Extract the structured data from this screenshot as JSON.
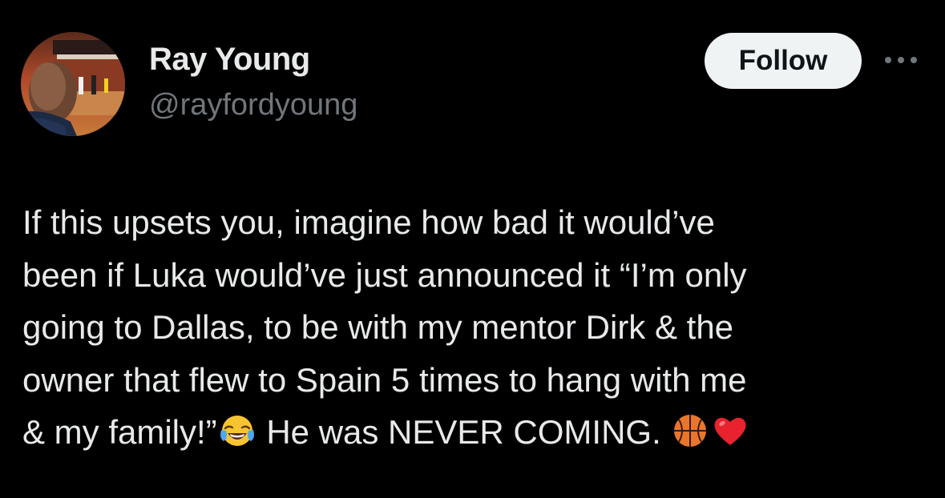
{
  "author": {
    "display_name": "Ray Young",
    "handle": "@rayfordyoung"
  },
  "actions": {
    "follow_label": "Follow",
    "more_icon": "more-horizontal-icon"
  },
  "tweet": {
    "lines": [
      "If this upsets you, imagine how bad it would’ve",
      "been if Luka would’ve just announced it “I’m only",
      "going to Dallas, to be with my mentor Dirk & the",
      "owner that flew to Spain 5 times to hang with me"
    ],
    "last_line_part1": "& my family!”",
    "last_line_part2": " He was NEVER COMING. ",
    "emojis": [
      "tears-of-joy-emoji",
      "basketball-emoji",
      "red-heart-emoji"
    ]
  },
  "colors": {
    "background": "#000000",
    "text_primary": "#e7e9ea",
    "text_secondary": "#71767b",
    "follow_bg": "#eff3f4",
    "follow_text": "#0f1419"
  }
}
